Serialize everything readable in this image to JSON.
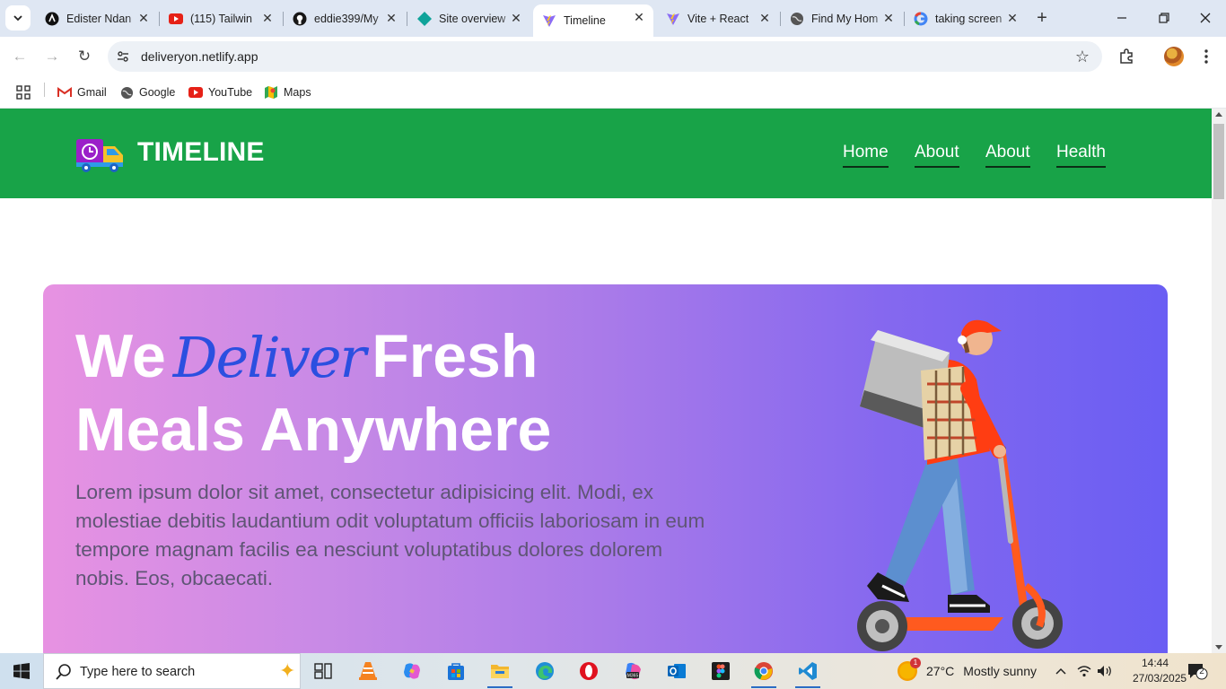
{
  "browser": {
    "tabs": [
      {
        "title": "Edister Ndan",
        "icon": "notion-icon"
      },
      {
        "title": "(115) Tailwin",
        "icon": "youtube-icon"
      },
      {
        "title": "eddie399/My",
        "icon": "github-icon"
      },
      {
        "title": "Site overview",
        "icon": "netlify-icon"
      },
      {
        "title": "Timeline",
        "icon": "vite-icon",
        "active": true
      },
      {
        "title": "Vite + React",
        "icon": "vite-icon"
      },
      {
        "title": "Find My Hom",
        "icon": "globe-icon"
      },
      {
        "title": "taking screen",
        "icon": "google-icon"
      }
    ],
    "url": "deliveryon.netlify.app",
    "bookmarks": [
      {
        "label": "Gmail",
        "icon": "gmail-icon"
      },
      {
        "label": "Google",
        "icon": "globe-icon"
      },
      {
        "label": "YouTube",
        "icon": "youtube-icon"
      },
      {
        "label": "Maps",
        "icon": "maps-icon"
      }
    ]
  },
  "site": {
    "brand": "TIMELINE",
    "nav": [
      "Home",
      "About",
      "About",
      "Health"
    ],
    "hero": {
      "title_pre": "We",
      "title_script": "Deliver",
      "title_post": "Fresh",
      "title_line2": "Meals Anywhere",
      "lead": "Lorem ipsum dolor sit amet, consectetur adipisicing elit. Modi, ex molestiae debitis laudantium odit voluptatum officiis laboriosam in eum tempore magnam facilis ea nesciunt voluptatibus dolores dolorem nobis. Eos, obcaecati."
    },
    "colors": {
      "header": "#18a348",
      "hero_start": "#e792e2",
      "hero_end": "#6a5ef3",
      "script": "#2b4fe0"
    }
  },
  "taskbar": {
    "search_placeholder": "Type here to search",
    "weather_temp": "27°C",
    "weather_desc": "Mostly sunny",
    "weather_badge": "1",
    "time": "14:44",
    "date": "27/03/2025",
    "notifications": "2",
    "apps": [
      "task-view-icon",
      "vlc-icon",
      "copilot-icon",
      "store-icon",
      "file-explorer-icon",
      "edge-icon",
      "opera-icon",
      "m365-icon",
      "outlook-icon",
      "figma-icon",
      "chrome-icon",
      "vscode-icon"
    ]
  }
}
